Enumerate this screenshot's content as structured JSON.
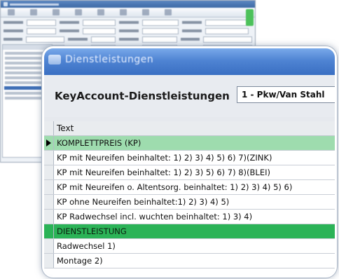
{
  "panel": {
    "window_title": "Dienstleistungen",
    "heading": "KeyAccount-Dienstleistungen",
    "customer_select_value": "1 - Pkw/Van Stahl"
  },
  "grid": {
    "column_header": "Text",
    "rows": [
      {
        "text": "KOMPLETTPREIS (KP)",
        "kind": "group-light",
        "selected": true
      },
      {
        "text": "KP mit Neureifen beinhaltet: 1) 2) 3) 4) 5) 6) 7)(ZINK)",
        "kind": "normal"
      },
      {
        "text": "KP mit Neureifen beinhaltet: 1) 2) 3) 5) 6) 7) 8)(BLEI)",
        "kind": "normal"
      },
      {
        "text": "KP mit Neureifen o. Altentsorg. beinhaltet: 1) 2) 3) 4) 5) 6)",
        "kind": "normal"
      },
      {
        "text": "KP ohne Neureifen beinhaltet:1) 2) 3) 4) 5)",
        "kind": "normal"
      },
      {
        "text": "KP Radwechsel incl. wuchten beinhaltet: 1) 3) 4)",
        "kind": "normal"
      },
      {
        "text": "DIENSTLEISTUNG",
        "kind": "group-dark"
      },
      {
        "text": "Radwechsel 1)",
        "kind": "normal"
      },
      {
        "text": "Montage 2)",
        "kind": "normal"
      }
    ]
  },
  "colors": {
    "group_light": "#9edcae",
    "group_dark": "#2bb357",
    "titlebar": "#4f84d3"
  }
}
